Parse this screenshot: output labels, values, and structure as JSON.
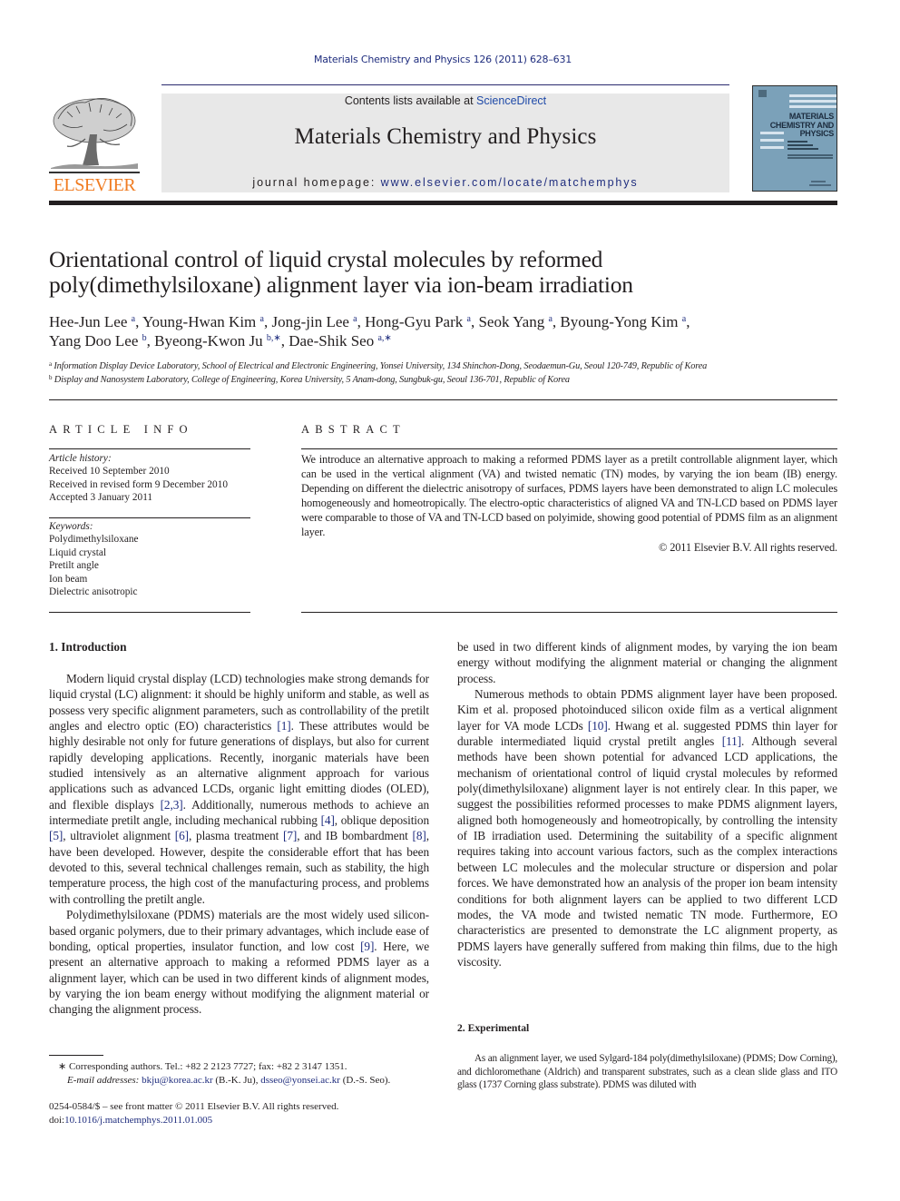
{
  "running_head": "Materials Chemistry and Physics 126 (2011) 628–631",
  "publisher": {
    "logo_word": "ELSEVIER",
    "logo_color": "#f07c22"
  },
  "banner": {
    "contents_prefix": "Contents lists available at ",
    "contents_link": "ScienceDirect",
    "journal_name": "Materials Chemistry and Physics",
    "homepage_prefix": "journal homepage: ",
    "homepage_link": "www.elsevier.com/locate/matchemphys"
  },
  "cover": {
    "title_lines": [
      "MATERIALS",
      "CHEMISTRY AND",
      "PHYSICS"
    ],
    "background_color": "#7ba1b9"
  },
  "article": {
    "title_line1": "Orientational control of liquid crystal molecules by reformed",
    "title_line2": "poly(dimethylsiloxane) alignment layer via ion-beam irradiation",
    "authors": [
      {
        "name": "Hee-Jun Lee",
        "aff": "a"
      },
      {
        "name": "Young-Hwan Kim",
        "aff": "a"
      },
      {
        "name": "Jong-jin Lee",
        "aff": "a"
      },
      {
        "name": "Hong-Gyu Park",
        "aff": "a"
      },
      {
        "name": "Seok Yang",
        "aff": "a"
      },
      {
        "name": "Byoung-Yong Kim",
        "aff": "a"
      },
      {
        "name": "Yang Doo Lee",
        "aff": "b"
      },
      {
        "name": "Byeong-Kwon Ju",
        "aff": "b,∗"
      },
      {
        "name": "Dae-Shik Seo",
        "aff": "a,∗"
      }
    ],
    "affiliations": [
      {
        "mark": "a",
        "text": "Information Display Device Laboratory, School of Electrical and Electronic Engineering, Yonsei University, 134 Shinchon-Dong, Seodaemun-Gu, Seoul 120-749, Republic of Korea"
      },
      {
        "mark": "b",
        "text": "Display and Nanosystem Laboratory, College of Engineering, Korea University, 5 Anam-dong, Sungbuk-gu, Seoul 136-701, Republic of Korea"
      }
    ]
  },
  "article_info": {
    "heading": "ARTICLE INFO",
    "history_label": "Article history:",
    "history": [
      "Received 10 September 2010",
      "Received in revised form 9 December 2010",
      "Accepted 3 January 2011"
    ],
    "keywords_label": "Keywords:",
    "keywords": [
      "Polydimethylsiloxane",
      "Liquid crystal",
      "Pretilt angle",
      "Ion beam",
      "Dielectric anisotropic"
    ]
  },
  "abstract": {
    "heading": "ABSTRACT",
    "text": "We introduce an alternative approach to making a reformed PDMS layer as a pretilt controllable alignment layer, which can be used in the vertical alignment (VA) and twisted nematic (TN) modes, by varying the ion beam (IB) energy. Depending on different the dielectric anisotropy of surfaces, PDMS layers have been demonstrated to align LC molecules homogeneously and homeotropically. The electro-optic characteristics of aligned VA and TN-LCD based on PDMS layer were comparable to those of VA and TN-LCD based on polyimide, showing good potential of PDMS film as an alignment layer.",
    "copyright": "© 2011 Elsevier B.V. All rights reserved."
  },
  "sections": {
    "intro_heading": "1.  Introduction",
    "intro_p1": [
      {
        "t": "Modern liquid crystal display (LCD) technologies make strong demands for liquid crystal (LC) alignment: it should be highly uniform and stable, as well as possess very specific alignment parameters, such as controllability of the pretilt angles and electro optic (EO) characteristics "
      },
      {
        "ref": "[1]"
      },
      {
        "t": ". These attributes would be highly desirable not only for future generations of displays, but also for current rapidly developing applications. Recently, inorganic materials have been studied intensively as an alternative alignment approach for various applications such as advanced LCDs, organic light emitting diodes (OLED), and flexible displays "
      },
      {
        "ref": "[2,3]"
      },
      {
        "t": ". Additionally, numerous methods to achieve an intermediate pretilt angle, including mechanical rubbing "
      },
      {
        "ref": "[4]"
      },
      {
        "t": ", oblique deposition "
      },
      {
        "ref": "[5]"
      },
      {
        "t": ", ultraviolet alignment "
      },
      {
        "ref": "[6]"
      },
      {
        "t": ", plasma treatment "
      },
      {
        "ref": "[7]"
      },
      {
        "t": ", and IB bombardment "
      },
      {
        "ref": "[8]"
      },
      {
        "t": ", have been developed. However, despite the considerable effort that has been devoted to this, several technical challenges remain, such as stability, the high temperature process, the high cost of the manufacturing process, and problems with controlling the pretilt angle."
      }
    ],
    "intro_p2": [
      {
        "t": "Polydimethylsiloxane (PDMS) materials are the most widely used silicon-based organic polymers, due to their primary advantages, which include ease of bonding, optical properties, insulator function, and low cost "
      },
      {
        "ref": "[9]"
      },
      {
        "t": ". Here, we present an alternative approach to making a reformed PDMS layer as a alignment layer, which can be used in two different kinds of alignment modes, by varying the ion beam energy without modifying the alignment material or changing the alignment process."
      }
    ],
    "intro_p3": [
      {
        "t": "Numerous methods to obtain PDMS alignment layer have been proposed. Kim et al. proposed photoinduced silicon oxide film as a vertical alignment layer for VA mode LCDs "
      },
      {
        "ref": "[10]"
      },
      {
        "t": ". Hwang et al. suggested PDMS thin layer for durable intermediated liquid crystal pretilt angles "
      },
      {
        "ref": "[11]"
      },
      {
        "t": ". Although several methods have been shown potential for advanced LCD applications, the mechanism of orientational control of liquid crystal molecules by reformed poly(dimethylsiloxane) alignment layer is not entirely clear. In this paper, we suggest the possibilities reformed processes to make PDMS alignment layers, aligned both homogeneously and homeotropically, by controlling the intensity of IB irradiation used. Determining the suitability of a specific alignment requires taking into account various factors, such as the complex interactions between LC molecules and the molecular structure or dispersion and polar forces. We have demonstrated how an analysis of the proper ion beam intensity conditions for both alignment layers can be applied to two different LCD modes, the VA mode and twisted nematic TN mode. Furthermore, EO characteristics are presented to demonstrate the LC alignment property, as PDMS layers have generally suffered from making thin films, due to the high viscosity."
      }
    ],
    "exp_heading": "2.  Experimental",
    "exp_p1": "As an alignment layer, we used Sylgard-184 poly(dimethylsiloxane) (PDMS; Dow Corning), and dichloromethane (Aldrich) and transparent substrates, such as a clean slide glass and ITO glass (1737 Corning glass substrate). PDMS was diluted with"
  },
  "footnotes": {
    "corresponding": "∗  Corresponding authors. Tel.: +82 2 2123 7727; fax: +82 2 3147 1351.",
    "email_label": "E-mail addresses:",
    "email1": "bkju@korea.ac.kr",
    "email1_owner": " (B.-K. Ju), ",
    "email2": "dsseo@yonsei.ac.kr",
    "email2_owner": " (D.-S. Seo).",
    "front_matter": "0254-0584/$ – see front matter © 2011 Elsevier B.V. All rights reserved.",
    "doi_prefix": "doi:",
    "doi": "10.1016/j.matchemphys.2011.01.005"
  },
  "colors": {
    "link": "#1f2d7e",
    "banner_bg": "#e8e8e8",
    "text": "#231f20"
  }
}
